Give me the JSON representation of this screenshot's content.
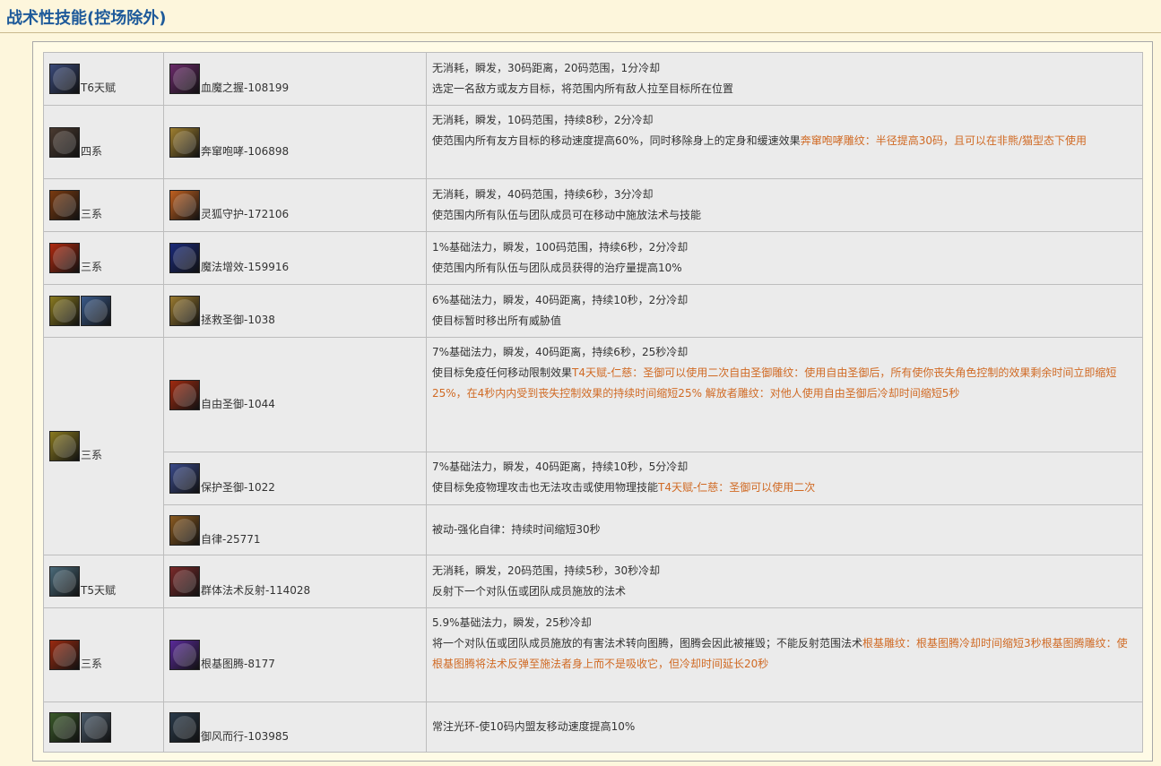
{
  "page_title": "战术性技能(控场除外)",
  "rows": [
    {
      "spec": {
        "label": "T6天赋",
        "icons": [
          {
            "name": "talent-t6-icon",
            "color": "#3a4a7a"
          }
        ]
      },
      "skill": {
        "label": "血魔之握-108199",
        "icon": {
          "name": "blood-grip-icon",
          "color": "#6a2a6a"
        }
      },
      "lines": [
        {
          "text": "无消耗，瞬发，30码距离，20码范围，1分冷却",
          "accent": ""
        },
        {
          "text": "选定一名敌方或友方目标，将范围内所有敌人拉至目标所在位置",
          "accent": ""
        }
      ]
    },
    {
      "spec": {
        "label": "四系",
        "icons": [
          {
            "name": "spider-icon",
            "color": "#4a3a30"
          }
        ]
      },
      "skill": {
        "label": "奔窜咆哮-106898",
        "icon": {
          "name": "roar-icon",
          "color": "#a08030"
        }
      },
      "lines": [
        {
          "text": "无消耗，瞬发，10码范围，持续8秒，2分冷却",
          "accent": ""
        },
        {
          "text": "使范围内所有友方目标的移动速度提高60%，同时移除身上的定身和缓速效果",
          "accent": "奔窜咆哮雕纹：半径提高30码，且可以在非熊/猫型态下使用"
        }
      ]
    },
    {
      "spec": {
        "label": "三系",
        "icons": [
          {
            "name": "hunter-bow-icon",
            "color": "#7a3a10"
          }
        ]
      },
      "skill": {
        "label": "灵狐守护-172106",
        "icon": {
          "name": "fox-icon",
          "color": "#c06020"
        }
      },
      "lines": [
        {
          "text": "无消耗，瞬发，40码范围，持续6秒，3分冷却",
          "accent": ""
        },
        {
          "text": "使范围内所有队伍与团队成员可在移动中施放法术与技能",
          "accent": ""
        }
      ]
    },
    {
      "spec": {
        "label": "三系",
        "icons": [
          {
            "name": "fire-staff-icon",
            "color": "#b02a10"
          }
        ]
      },
      "skill": {
        "label": "魔法增效-159916",
        "icon": {
          "name": "amplify-magic-icon",
          "color": "#1a2a7a"
        }
      },
      "lines": [
        {
          "text": "1%基础法力，瞬发，100码范围，持续6秒，2分冷却",
          "accent": ""
        },
        {
          "text": "使范围内所有队伍与团队成员获得的治疗量提高10%",
          "accent": ""
        }
      ]
    },
    {
      "spec": {
        "label": "",
        "icons": [
          {
            "name": "holy-hammer-icon",
            "color": "#8a7a20"
          },
          {
            "name": "shield-icon",
            "color": "#3a5a8a"
          }
        ]
      },
      "skill": {
        "label": "拯救圣御-1038",
        "icon": {
          "name": "salvation-icon",
          "color": "#9a7a30"
        }
      },
      "lines": [
        {
          "text": "6%基础法力，瞬发，40码距离，持续10秒，2分冷却",
          "accent": ""
        },
        {
          "text": "使目标暂时移出所有威胁值",
          "accent": ""
        }
      ]
    },
    {
      "spec": {
        "label": "三系",
        "icons": [
          {
            "name": "holy-hammer-icon",
            "color": "#8a7a20"
          }
        ]
      },
      "skill": {
        "label": "自由圣御-1044",
        "icon": {
          "name": "freedom-icon",
          "color": "#a02a10"
        }
      },
      "lines": [
        {
          "text": "7%基础法力，瞬发，40码距离，持续6秒，25秒冷却",
          "accent": ""
        },
        {
          "text": "使目标免疫任何移动限制效果",
          "accent": "T4天赋-仁慈：圣御可以使用二次自由圣御雕纹：使用自由圣御后，所有使你丧失角色控制的效果剩余时间立即缩短25%，在4秒内内受到丧失控制效果的持续时间缩短25% 解放者雕纹：对他人使用自由圣御后冷却时间缩短5秒"
        }
      ]
    },
    {
      "spec": null,
      "skill": {
        "label": "保护圣御-1022",
        "icon": {
          "name": "protection-icon",
          "color": "#3a4a8a"
        }
      },
      "lines": [
        {
          "text": "7%基础法力，瞬发，40码距离，持续10秒，5分冷却",
          "accent": ""
        },
        {
          "text": "使目标免疫物理攻击也无法攻击或使用物理技能",
          "accent": "T4天赋-仁慈：圣御可以使用二次"
        }
      ]
    },
    {
      "spec": null,
      "skill": {
        "label": "自律-25771",
        "icon": {
          "name": "forbearance-icon",
          "color": "#8a5a20"
        }
      },
      "lines": [
        {
          "text": "被动-强化自律：持续时间缩短30秒",
          "accent": ""
        }
      ]
    },
    {
      "spec": {
        "label": "T5天赋",
        "icons": [
          {
            "name": "sword-icon",
            "color": "#4a6a7a"
          }
        ]
      },
      "skill": {
        "label": "群体法术反射-114028",
        "icon": {
          "name": "mass-reflect-icon",
          "color": "#7a2a2a"
        }
      },
      "lines": [
        {
          "text": "无消耗，瞬发，20码范围，持续5秒，30秒冷却",
          "accent": ""
        },
        {
          "text": "反射下一个对队伍或团队成员施放的法术",
          "accent": ""
        }
      ]
    },
    {
      "spec": {
        "label": "三系",
        "icons": [
          {
            "name": "shaman-totem-icon",
            "color": "#9a2a10"
          }
        ]
      },
      "skill": {
        "label": "根基图腾-8177",
        "icon": {
          "name": "grounding-totem-icon",
          "color": "#5a2a9a"
        }
      },
      "lines": [
        {
          "text": "5.9%基础法力，瞬发，25秒冷却",
          "accent": ""
        },
        {
          "text": "将一个对队伍或团队成员施放的有害法术转向图腾，图腾会因此被摧毁；不能反射范围法术",
          "accent": "根基雕纹：根基图腾冷却时间缩短3秒根基图腾雕纹：使根基图腾将法术反弹至施法者身上而不是吸收它，但冷却时间延长20秒"
        }
      ]
    },
    {
      "spec": {
        "label": "",
        "icons": [
          {
            "name": "beast-icon",
            "color": "#3a5a2a"
          },
          {
            "name": "wolf-icon",
            "color": "#4a5a6a"
          }
        ]
      },
      "skill": {
        "label": "御风而行-103985",
        "icon": {
          "name": "windwalk-icon",
          "color": "#2a3a4a"
        }
      },
      "lines": [
        {
          "text": "常注光环-使10码内盟友移动速度提高10%",
          "accent": ""
        }
      ]
    }
  ]
}
